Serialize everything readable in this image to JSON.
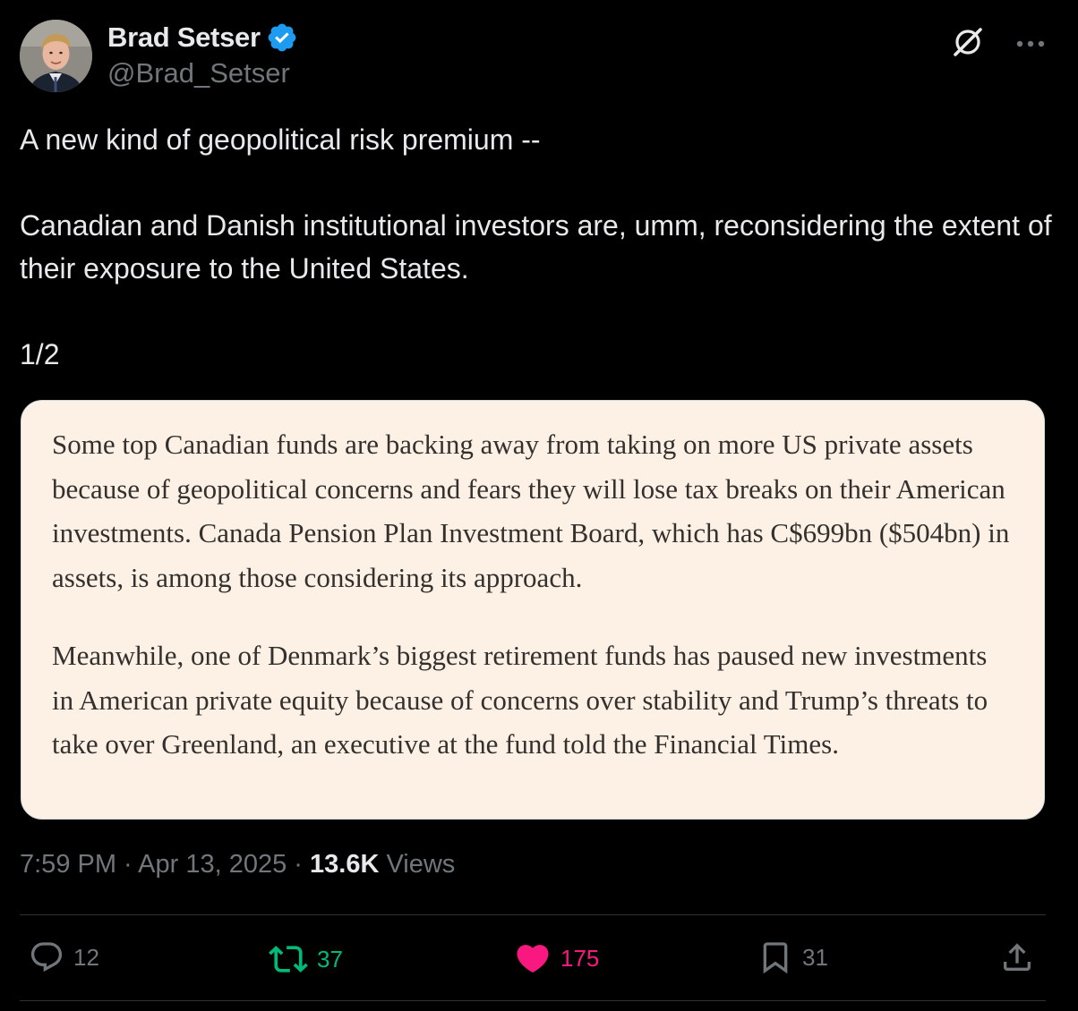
{
  "author": {
    "display_name": "Brad Setser",
    "handle": "@Brad_Setser",
    "verified": true,
    "avatar": "avatar-photo"
  },
  "top_icons": [
    "grok-icon",
    "more-icon"
  ],
  "tweet": {
    "line1": "A new kind of geopolitical risk premium --",
    "line2": "Canadian and Danish institutional investors are, umm, reconsidering the extent of their exposure to the United States.",
    "line3": "1/2"
  },
  "quote": {
    "paragraph1": "Some top Canadian funds are backing away from taking on more US private assets because of geopolitical concerns and fears they will lose tax breaks on their American investments. Canada Pension Plan Investment Board, which has C$699bn ($504bn) in assets, is among those considering its approach.",
    "paragraph2": "Meanwhile, one of Denmark’s biggest retirement funds has paused new investments in American private equity because of concerns over stability and Trump’s threats to take over Greenland, an executive at the fund told the Financial Times."
  },
  "meta": {
    "time": "7:59 PM",
    "separator": " · ",
    "date": "Apr 13, 2025",
    "views_count": "13.6K",
    "views_label": " Views"
  },
  "actions": {
    "replies": "12",
    "reposts": "37",
    "likes": "175",
    "bookmarks": "31"
  },
  "colors": {
    "background": "#000000",
    "text": "#e7e9ea",
    "secondary": "#71767b",
    "verified": "#1d9bf0",
    "repost": "#00ba7c",
    "like": "#f91880",
    "quote_bg": "#fdf1e5",
    "quote_text": "#33302e",
    "divider": "#2f3336"
  }
}
